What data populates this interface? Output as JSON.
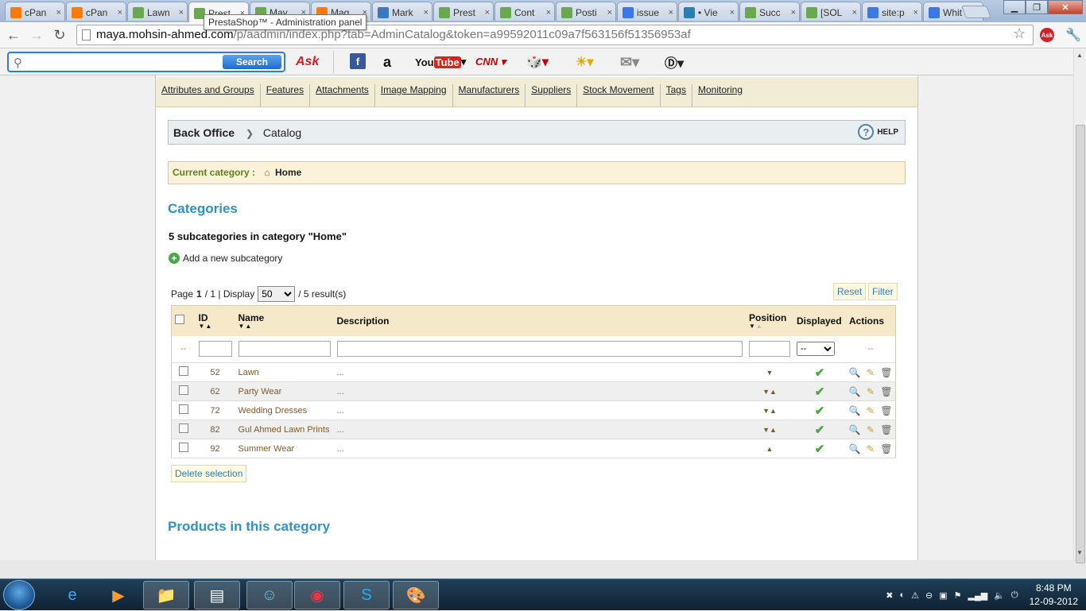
{
  "tabs": [
    {
      "label": "cPan",
      "icon": "cpanel-icon",
      "color": "#ff7a00"
    },
    {
      "label": "cPan",
      "icon": "cpanel-icon",
      "color": "#ff7a00"
    },
    {
      "label": "Lawn",
      "icon": "prestashop-icon",
      "color": "#6aa84f"
    },
    {
      "label": "Prest",
      "icon": "prestashop-icon",
      "color": "#6aa84f"
    },
    {
      "label": "May",
      "icon": "prestashop-icon",
      "color": "#6aa84f"
    },
    {
      "label": "Mag",
      "icon": "cpanel-icon",
      "color": "#ff7a00"
    },
    {
      "label": "Mark",
      "icon": "elephant-icon",
      "color": "#3b78c2"
    },
    {
      "label": "Prest",
      "icon": "prestashop-icon",
      "color": "#6aa84f"
    },
    {
      "label": "Cont",
      "icon": "prestashop-icon",
      "color": "#6aa84f"
    },
    {
      "label": "Posti",
      "icon": "prestashop-icon",
      "color": "#6aa84f"
    },
    {
      "label": "issue",
      "icon": "google-icon",
      "color": "#3b78e7"
    },
    {
      "label": "• Vie",
      "icon": "arrow-icon",
      "color": "#2b7fb8"
    },
    {
      "label": "Succ",
      "icon": "prestashop-icon",
      "color": "#6aa84f"
    },
    {
      "label": "[SOL",
      "icon": "prestashop-icon",
      "color": "#6aa84f"
    },
    {
      "label": "site:p",
      "icon": "google-icon",
      "color": "#3b78e7"
    },
    {
      "label": "Whit",
      "icon": "google-icon",
      "color": "#3b78e7"
    }
  ],
  "tab_tooltip": "PrestaShop™ - Administration panel",
  "close_glyph": "×",
  "url": {
    "domain": "maya.mohsin-ahmed.com",
    "path": "/p/aadmin/index.php?tab=AdminCatalog&token=a99592011c09a7f563156f51356953af"
  },
  "ask_toolbar": {
    "search_placeholder": "",
    "search_button": "Search",
    "ask_logo": "Ask"
  },
  "submenu": [
    "Attributes and Groups",
    "Features",
    "Attachments",
    "Image Mapping",
    "Manufacturers",
    "Suppliers",
    "Stock Movement",
    "Tags",
    "Monitoring"
  ],
  "breadcrumb": {
    "root": "Back Office",
    "current": "Catalog",
    "help": "HELP"
  },
  "current_category": {
    "label": "Current category :",
    "value": "Home"
  },
  "categories_heading": "Categories",
  "subcategory_count": "5 subcategories in category \"Home\"",
  "add_subcategory": "Add a new subcategory",
  "pager": {
    "page_prefix": "Page",
    "page": "1",
    "total_pages": "/ 1 | Display",
    "per_page": "50",
    "results": "/ 5 result(s)"
  },
  "buttons": {
    "reset": "Reset",
    "filter": "Filter",
    "delete_selection": "Delete selection"
  },
  "columns": {
    "id": "ID",
    "name": "Name",
    "description": "Description",
    "position": "Position",
    "displayed": "Displayed",
    "actions": "Actions"
  },
  "filters": {
    "dash": "--",
    "displayed_select": "--"
  },
  "rows": [
    {
      "id": "52",
      "name": "Lawn",
      "description": "...",
      "position": "▼",
      "displayed": "✔"
    },
    {
      "id": "62",
      "name": "Party Wear",
      "description": "...",
      "position": "▼▲",
      "displayed": "✔"
    },
    {
      "id": "72",
      "name": "Wedding Dresses",
      "description": "...",
      "position": "▼▲",
      "displayed": "✔"
    },
    {
      "id": "82",
      "name": "Gul Ahmed Lawn Prints",
      "description": "...",
      "position": "▼▲",
      "displayed": "✔"
    },
    {
      "id": "92",
      "name": "Summer Wear",
      "description": "...",
      "position": "▲",
      "displayed": "✔"
    }
  ],
  "products_heading": "Products in this category",
  "clock": {
    "time": "8:48 PM",
    "date": "12-09-2012"
  }
}
